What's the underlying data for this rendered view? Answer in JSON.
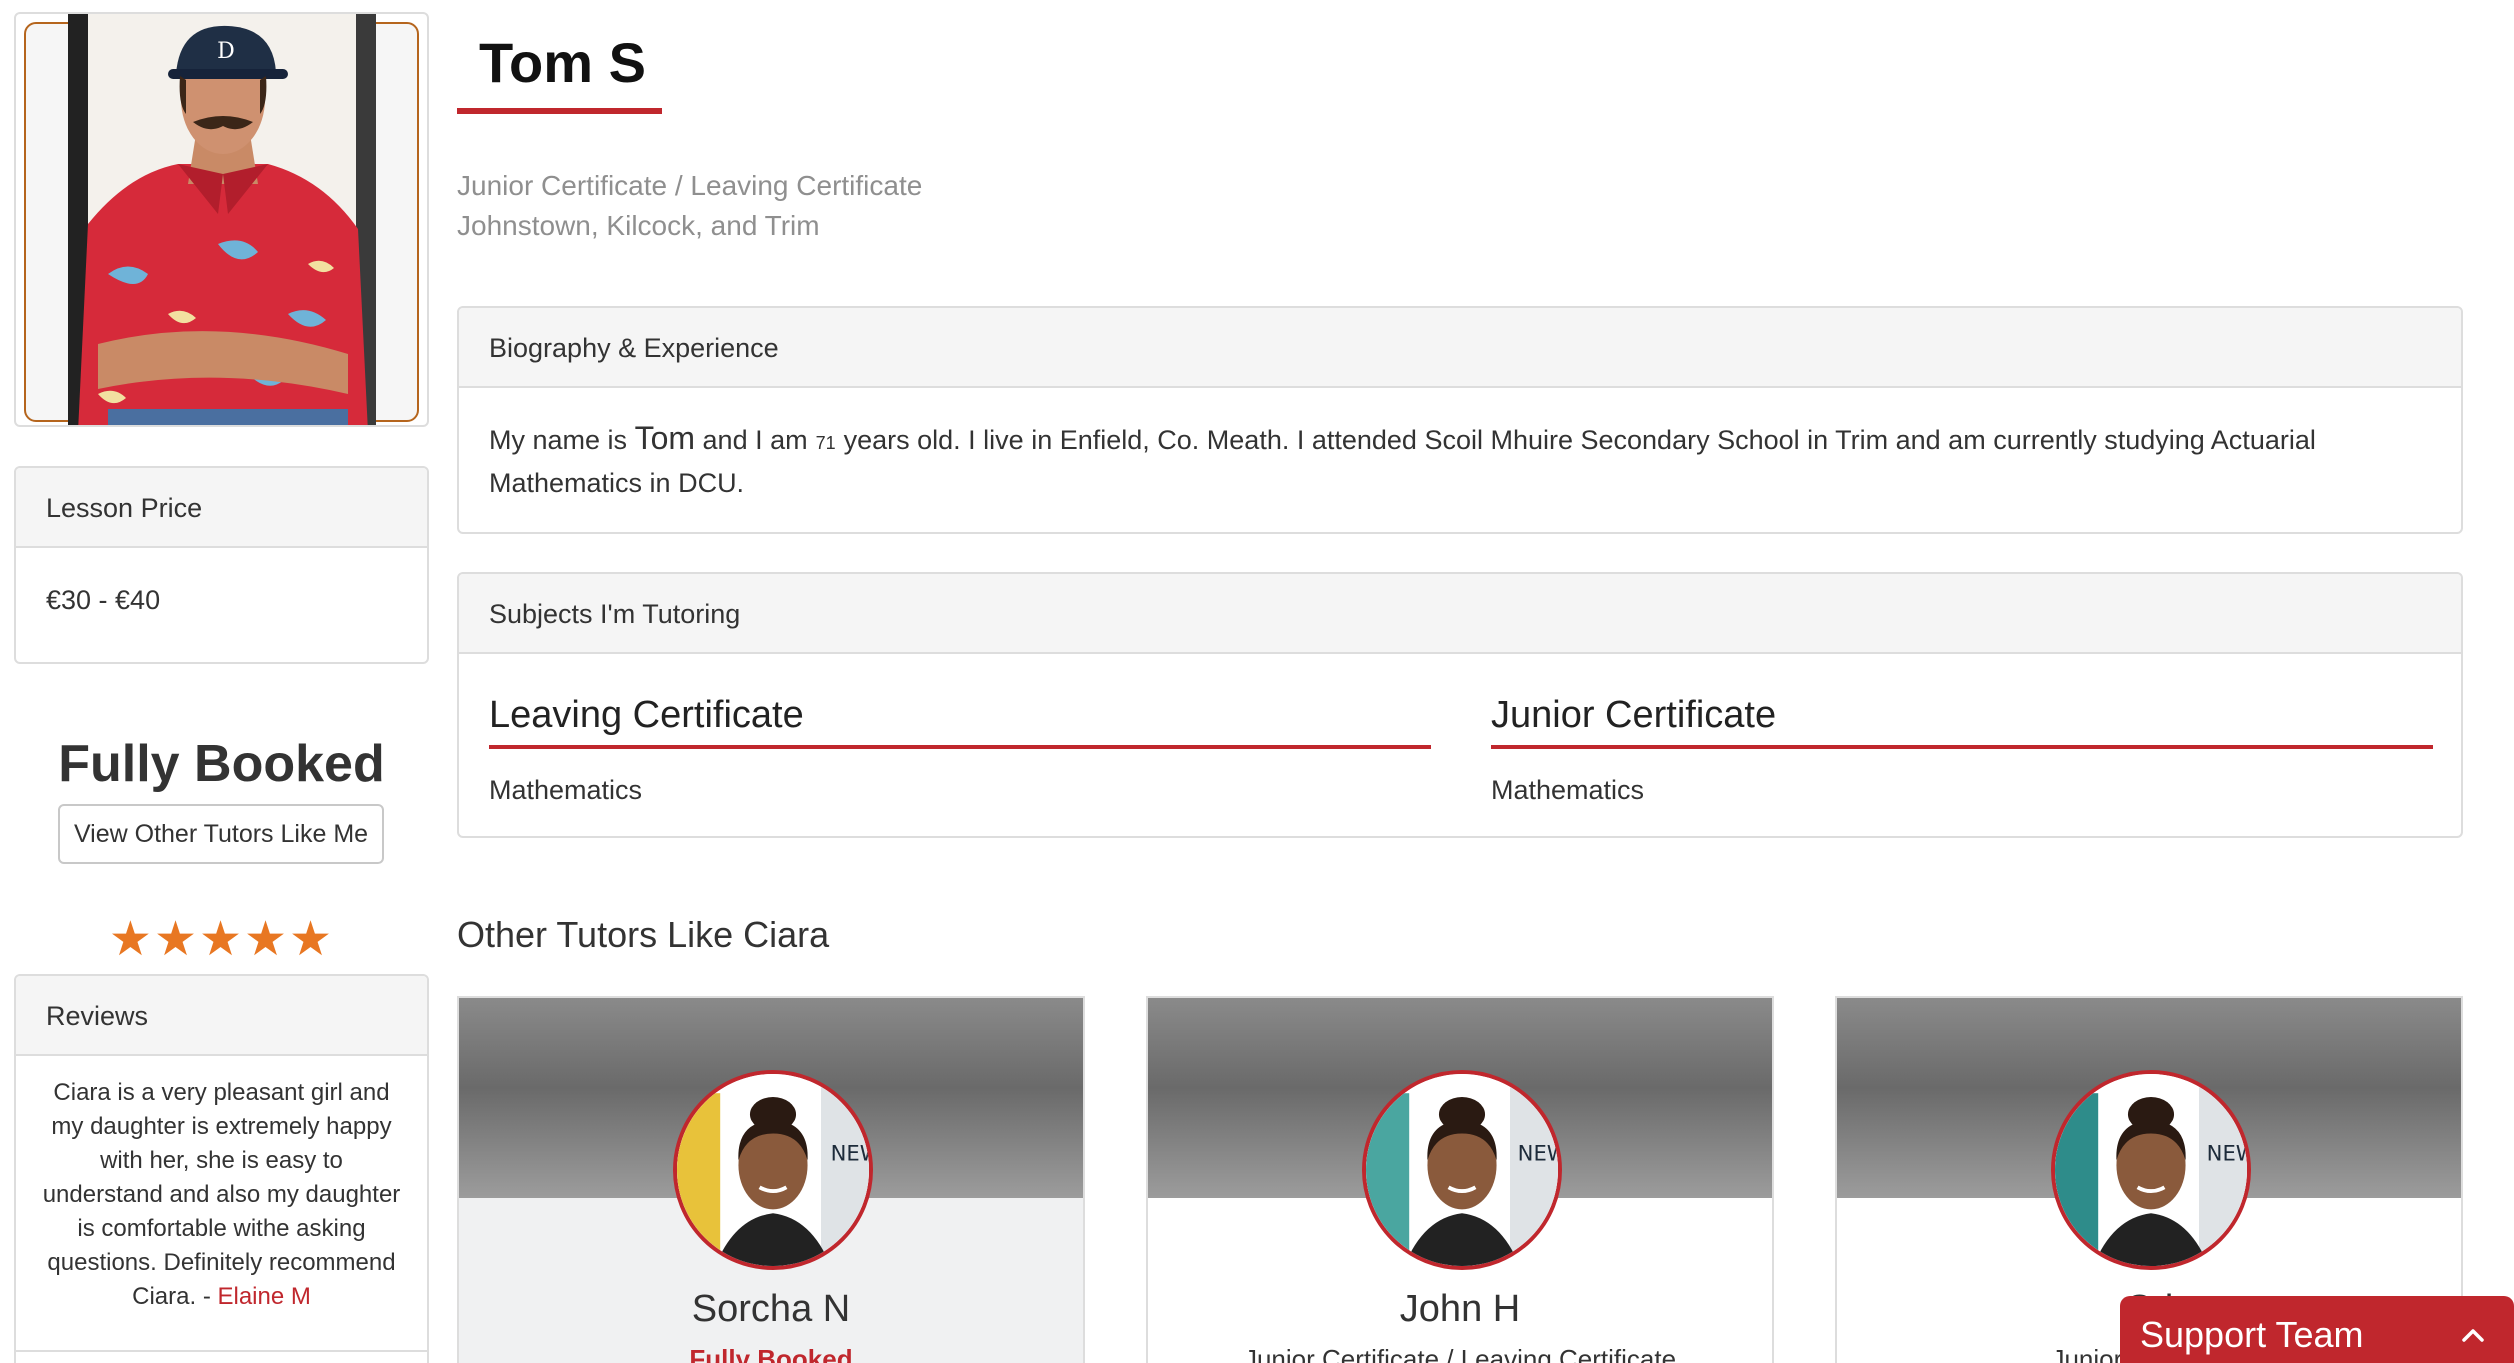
{
  "profile": {
    "name": "Tom S",
    "levels": "Junior Certificate / Leaving Certificate",
    "locations": "Johnstown, Kilcock, and Trim"
  },
  "lesson_price": {
    "heading": "Lesson Price",
    "value": "€30 - €40"
  },
  "availability": {
    "status": "Fully Booked",
    "button_label": "View Other Tutors Like Me"
  },
  "rating": {
    "stars_text": "★★★★★",
    "value": 5,
    "max": 5
  },
  "reviews": {
    "heading": "Reviews",
    "text": "Ciara is a very pleasant girl and my daughter is extremely happy with her, she is easy to understand and also my daughter is comfortable withe asking questions. Definitely recommend Ciara. - ",
    "author": "Elaine M"
  },
  "biography": {
    "heading": "Biography & Experience",
    "part1": "My name is",
    "name": "Tom",
    "part2": "and I am",
    "age": "71",
    "part3": "years old. I live in Enfield, Co. Meath. I attended Scoil Mhuire Secondary School in Trim and am currently studying Actuarial Mathematics in DCU."
  },
  "subjects": {
    "heading": "Subjects I'm Tutoring",
    "groups": [
      {
        "level": "Leaving Certificate",
        "subject": "Mathematics"
      },
      {
        "level": "Junior Certificate",
        "subject": "Mathematics"
      }
    ]
  },
  "other_tutors": {
    "heading": "Other Tutors Like Ciara",
    "cards": [
      {
        "name": "Sorcha N",
        "subtitle": "Fully Booked"
      },
      {
        "name": "John H",
        "subtitle": "Junior Certificate / Leaving Certificate"
      },
      {
        "name": "Cri",
        "subtitle": "Junior Certificate"
      }
    ]
  },
  "support": {
    "label": "Support Team",
    "icon": "chevron-up-icon"
  },
  "colors": {
    "accent": "#c0272d",
    "star": "#e87722",
    "muted_text": "#8f8f8f",
    "panel_heading_bg": "#f5f5f5",
    "border": "#dddddd"
  }
}
